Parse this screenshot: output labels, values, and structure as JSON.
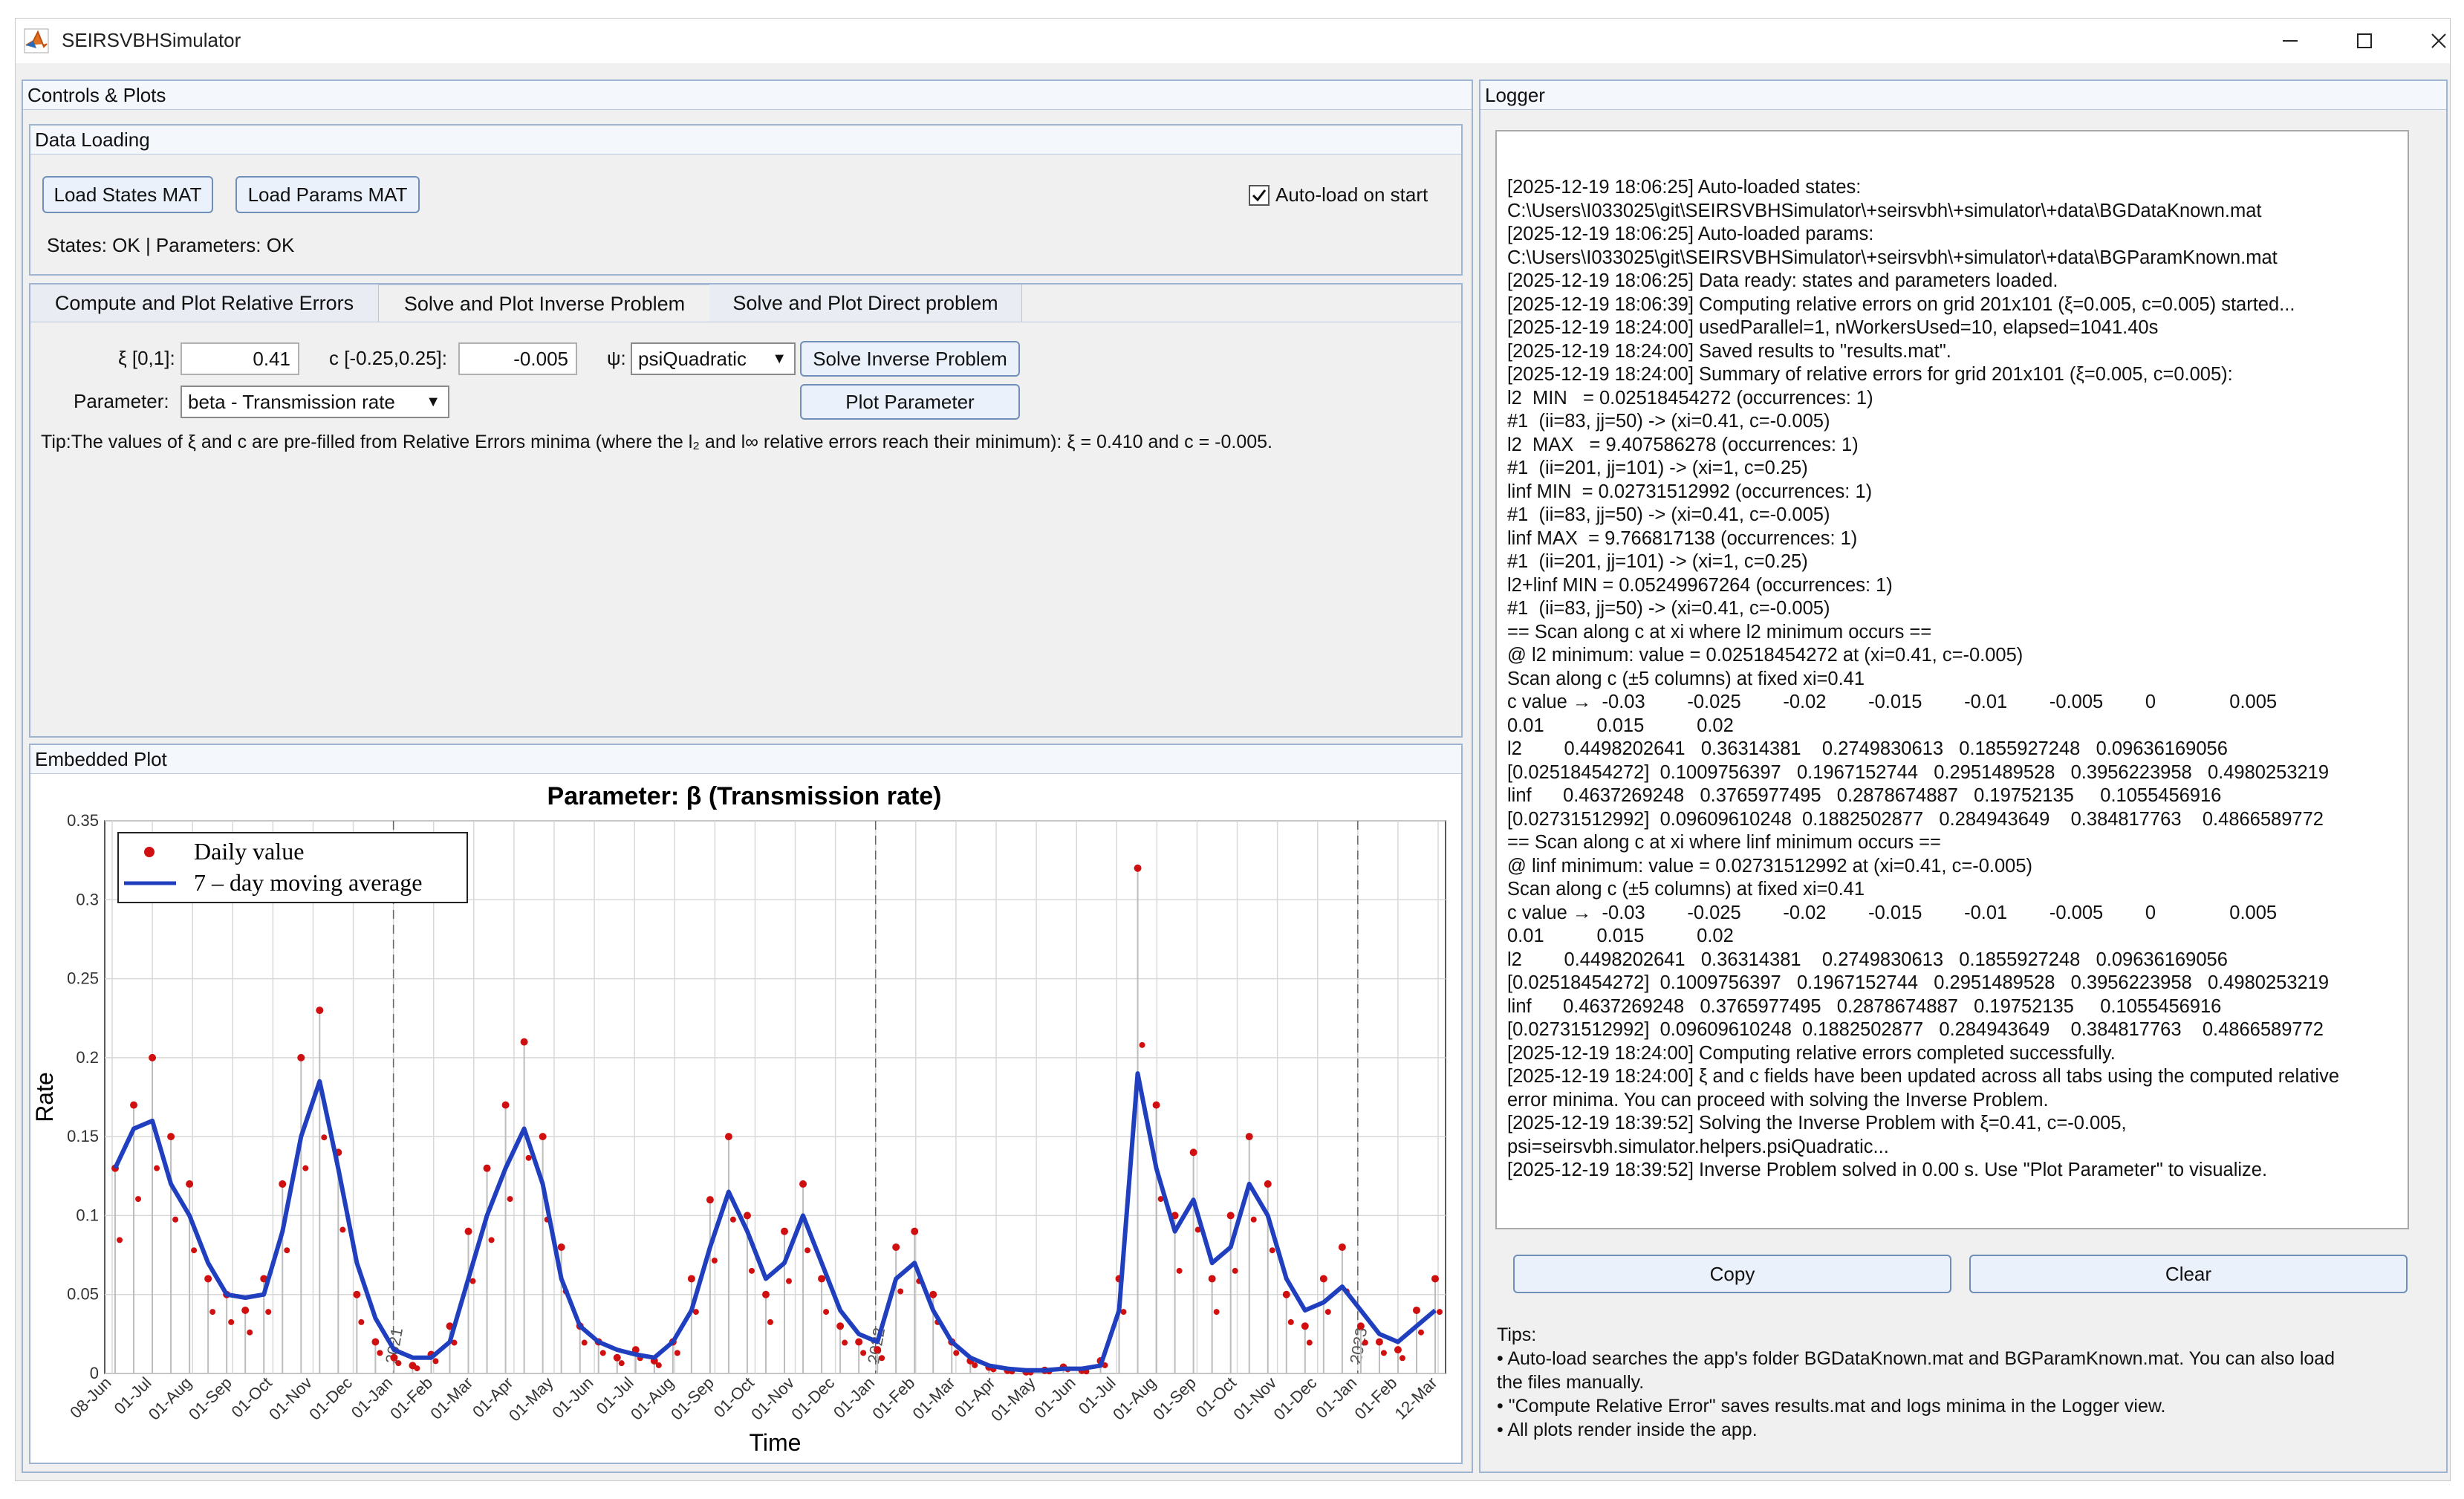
{
  "window": {
    "title": "SEIRSVBHSimulator"
  },
  "controls_panel": {
    "title": "Controls & Plots"
  },
  "data_loading": {
    "title": "Data Loading",
    "load_states_label": "Load States MAT",
    "load_params_label": "Load Params MAT",
    "autoload_label": "Auto-load on start",
    "autoload_checked": true,
    "status_text": "States: OK | Parameters: OK"
  },
  "tabs": [
    {
      "label": "Compute and Plot Relative Errors",
      "active": false
    },
    {
      "label": "Solve and Plot Inverse Problem",
      "active": true
    },
    {
      "label": "Solve and Plot Direct problem",
      "active": false
    }
  ],
  "inverse": {
    "xi_label": "ξ [0,1]:",
    "xi_value": "0.41",
    "c_label": "c [-0.25,0.25]:",
    "c_value": "-0.005",
    "psi_label": "ψ:",
    "psi_value": "psiQuadratic",
    "solve_label": "Solve Inverse Problem",
    "param_label": "Parameter:",
    "param_value": "beta - Transmission rate",
    "plot_label": "Plot Parameter",
    "tip": "Tip:The values of ξ and c are pre-filled from Relative Errors minima (where the l₂ and l∞ relative errors reach their minimum): ξ = 0.410 and c = -0.005."
  },
  "embedded_plot": {
    "title": "Embedded Plot"
  },
  "chart_data": {
    "type": "line",
    "title": "Parameter: β (Transmission rate)",
    "xlabel": "Time",
    "ylabel": "Rate",
    "ylim": [
      0,
      0.35
    ],
    "y_ticks": [
      "0",
      "0.05",
      "0.1",
      "0.15",
      "0.2",
      "0.25",
      "0.3",
      "0.35"
    ],
    "x_ticks": [
      "08-Jun",
      "01-Jul",
      "01-Aug",
      "01-Sep",
      "01-Oct",
      "01-Nov",
      "01-Dec",
      "01-Jan",
      "01-Feb",
      "01-Mar",
      "01-Apr",
      "01-May",
      "01-Jun",
      "01-Jul",
      "01-Aug",
      "01-Sep",
      "01-Oct",
      "01-Nov",
      "01-Dec",
      "01-Jan",
      "01-Feb",
      "01-Mar",
      "01-Apr",
      "01-May",
      "01-Jun",
      "01-Jul",
      "01-Aug",
      "01-Sep",
      "01-Oct",
      "01-Nov",
      "01-Dec",
      "01-Jan",
      "01-Feb",
      "12-Mar"
    ],
    "year_marks": [
      "2021",
      "2022",
      "2023"
    ],
    "grid": true,
    "legend_position": "top-left",
    "series": [
      {
        "name": "7 – day moving average",
        "color": "#1f3fbf",
        "values": [
          0.13,
          0.155,
          0.16,
          0.12,
          0.1,
          0.07,
          0.05,
          0.048,
          0.05,
          0.09,
          0.15,
          0.185,
          0.13,
          0.07,
          0.035,
          0.015,
          0.01,
          0.01,
          0.02,
          0.06,
          0.1,
          0.13,
          0.155,
          0.12,
          0.06,
          0.03,
          0.02,
          0.015,
          0.012,
          0.01,
          0.02,
          0.04,
          0.08,
          0.115,
          0.09,
          0.06,
          0.07,
          0.1,
          0.07,
          0.04,
          0.025,
          0.02,
          0.06,
          0.07,
          0.04,
          0.02,
          0.01,
          0.005,
          0.003,
          0.002,
          0.002,
          0.003,
          0.003,
          0.005,
          0.04,
          0.19,
          0.13,
          0.09,
          0.11,
          0.07,
          0.08,
          0.12,
          0.1,
          0.06,
          0.04,
          0.045,
          0.055,
          0.04,
          0.025,
          0.02,
          0.03,
          0.04
        ]
      },
      {
        "name": "Daily value",
        "color": "#d01010",
        "marker": "dot",
        "values": [
          0.13,
          0.17,
          0.2,
          0.15,
          0.12,
          0.06,
          0.05,
          0.04,
          0.06,
          0.12,
          0.2,
          0.23,
          0.14,
          0.05,
          0.02,
          0.01,
          0.005,
          0.012,
          0.03,
          0.09,
          0.13,
          0.17,
          0.21,
          0.15,
          0.08,
          0.03,
          0.02,
          0.01,
          0.015,
          0.008,
          0.02,
          0.06,
          0.11,
          0.15,
          0.1,
          0.05,
          0.09,
          0.12,
          0.06,
          0.03,
          0.02,
          0.015,
          0.08,
          0.09,
          0.05,
          0.02,
          0.008,
          0.004,
          0.002,
          0.001,
          0.002,
          0.004,
          0.002,
          0.008,
          0.06,
          0.32,
          0.17,
          0.1,
          0.14,
          0.06,
          0.1,
          0.15,
          0.12,
          0.05,
          0.03,
          0.06,
          0.08,
          0.03,
          0.02,
          0.015,
          0.04,
          0.06
        ]
      }
    ]
  },
  "logger": {
    "title": "Logger",
    "lines": [
      "[2025-12-19 18:06:25] Auto-loaded states:",
      "C:\\Users\\I033025\\git\\SEIRSVBHSimulator\\+seirsvbh\\+simulator\\+data\\BGDataKnown.mat",
      "[2025-12-19 18:06:25] Auto-loaded params:",
      "C:\\Users\\I033025\\git\\SEIRSVBHSimulator\\+seirsvbh\\+simulator\\+data\\BGParamKnown.mat",
      "[2025-12-19 18:06:25] Data ready: states and parameters loaded.",
      "[2025-12-19 18:06:39] Computing relative errors on grid 201x101 (ξ=0.005, c=0.005) started...",
      "[2025-12-19 18:24:00] usedParallel=1, nWorkersUsed=10, elapsed=1041.40s",
      "[2025-12-19 18:24:00] Saved results to \"results.mat\".",
      "[2025-12-19 18:24:00] Summary of relative errors for grid 201x101 (ξ=0.005, c=0.005):",
      "l2  MIN   = 0.02518454272 (occurrences: 1)",
      "#1  (ii=83, jj=50) -> (xi=0.41, c=-0.005)",
      "l2  MAX   = 9.407586278 (occurrences: 1)",
      "#1  (ii=201, jj=101) -> (xi=1, c=0.25)",
      "linf MIN  = 0.02731512992 (occurrences: 1)",
      "#1  (ii=83, jj=50) -> (xi=0.41, c=-0.005)",
      "linf MAX  = 9.766817138 (occurrences: 1)",
      "#1  (ii=201, jj=101) -> (xi=1, c=0.25)",
      "l2+linf MIN = 0.05249967264 (occurrences: 1)",
      "#1  (ii=83, jj=50) -> (xi=0.41, c=-0.005)",
      "== Scan along c at xi where l2 minimum occurs ==",
      "@ l2 minimum: value = 0.02518454272 at (xi=0.41, c=-0.005)",
      "Scan along c (±5 columns) at fixed xi=0.41",
      "c value →  -0.03        -0.025        -0.02        -0.015        -0.01        -0.005        0              0.005",
      "0.01          0.015          0.02",
      "l2        0.4498202641   0.36314381    0.2749830613   0.1855927248   0.09636169056",
      "[0.02518454272]  0.1009756397   0.1967152744   0.2951489528   0.3956223958   0.4980253219",
      "linf      0.4637269248   0.3765977495   0.2878674887   0.19752135     0.1055456916",
      "[0.02731512992]  0.09609610248  0.1882502877   0.284943649    0.384817763    0.4866589772",
      "== Scan along c at xi where linf minimum occurs ==",
      "@ linf minimum: value = 0.02731512992 at (xi=0.41, c=-0.005)",
      "Scan along c (±5 columns) at fixed xi=0.41",
      "c value →  -0.03        -0.025        -0.02        -0.015        -0.01        -0.005        0              0.005",
      "0.01          0.015          0.02",
      "l2        0.4498202641   0.36314381    0.2749830613   0.1855927248   0.09636169056",
      "[0.02518454272]  0.1009756397   0.1967152744   0.2951489528   0.3956223958   0.4980253219",
      "linf      0.4637269248   0.3765977495   0.2878674887   0.19752135     0.1055456916",
      "[0.02731512992]  0.09609610248  0.1882502877   0.284943649    0.384817763    0.4866589772",
      "[2025-12-19 18:24:00] Computing relative errors completed successfully.",
      "[2025-12-19 18:24:00] ξ and c fields have been updated across all tabs using the computed relative",
      "error minima. You can proceed with solving the Inverse Problem.",
      "[2025-12-19 18:39:52] Solving the Inverse Problem with ξ=0.41, c=-0.005,",
      "psi=seirsvbh.simulator.helpers.psiQuadratic...",
      "[2025-12-19 18:39:52] Inverse Problem solved in 0.00 s. Use \"Plot Parameter\" to visualize."
    ],
    "copy_label": "Copy",
    "clear_label": "Clear",
    "tips_title": "Tips:",
    "tips": [
      "• Auto-load searches the app's folder BGDataKnown.mat and BGParamKnown.mat. You can also load",
      "the files manually.",
      "• \"Compute Relative Error\" saves results.mat and logs minima in the Logger view.",
      "• All plots render inside the app."
    ]
  }
}
